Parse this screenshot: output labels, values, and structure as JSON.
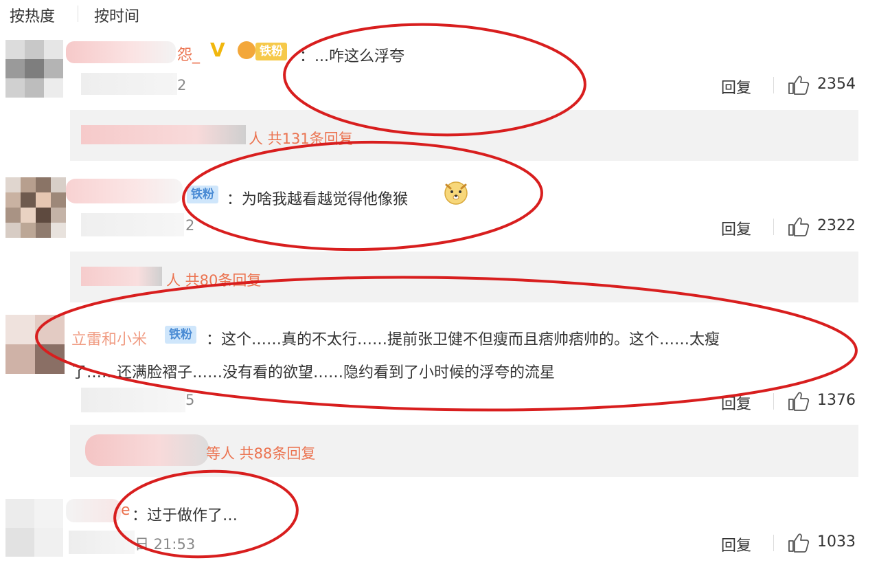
{
  "tabs": [
    {
      "label": "按热度"
    },
    {
      "label": "按时间"
    }
  ],
  "comments": [
    {
      "name_fragment": "怨_",
      "badge": "铁粉",
      "text": "：...咋这么浮夸",
      "meta_fragment": "2",
      "reply_label": "回复",
      "likes": "2354",
      "replies_text": "人 共131条回复"
    },
    {
      "name_fragment": "",
      "badge": "铁粉",
      "text": "：为啥我越看越觉得他像猴",
      "meta_fragment": "2",
      "reply_label": "回复",
      "likes": "2322",
      "replies_text": "人 共80条回复"
    },
    {
      "name_fragment": "立雷和小米",
      "badge": "铁粉",
      "text_line1": "：这个……真的不太行……提前张卫健不但瘦而且痞帅痞帅的。这个……太瘦",
      "text_line2": "了……还满脸褶子……没有看的欲望……隐约看到了小时候的浮夸的流星",
      "meta_fragment": "5",
      "reply_label": "回复",
      "likes": "1376",
      "replies_text": "等人 共88条回复"
    },
    {
      "name_fragment": "e",
      "text": "：过于做作了…",
      "meta_fragment": "日 21:53",
      "reply_label": "回复",
      "likes": "1033"
    }
  ],
  "icons": {
    "like": "thumbs-up-icon",
    "vip": "v-verified-icon",
    "emoji": "dog-face-emoji-icon",
    "fan": "fan-home-icon"
  },
  "colors": {
    "accent": "#eb7350",
    "annotation": "#d81e1e",
    "reply_bg": "#f2f2f2",
    "badge_blue": "#cfe6fb",
    "badge_gold": "#f6c94a"
  }
}
